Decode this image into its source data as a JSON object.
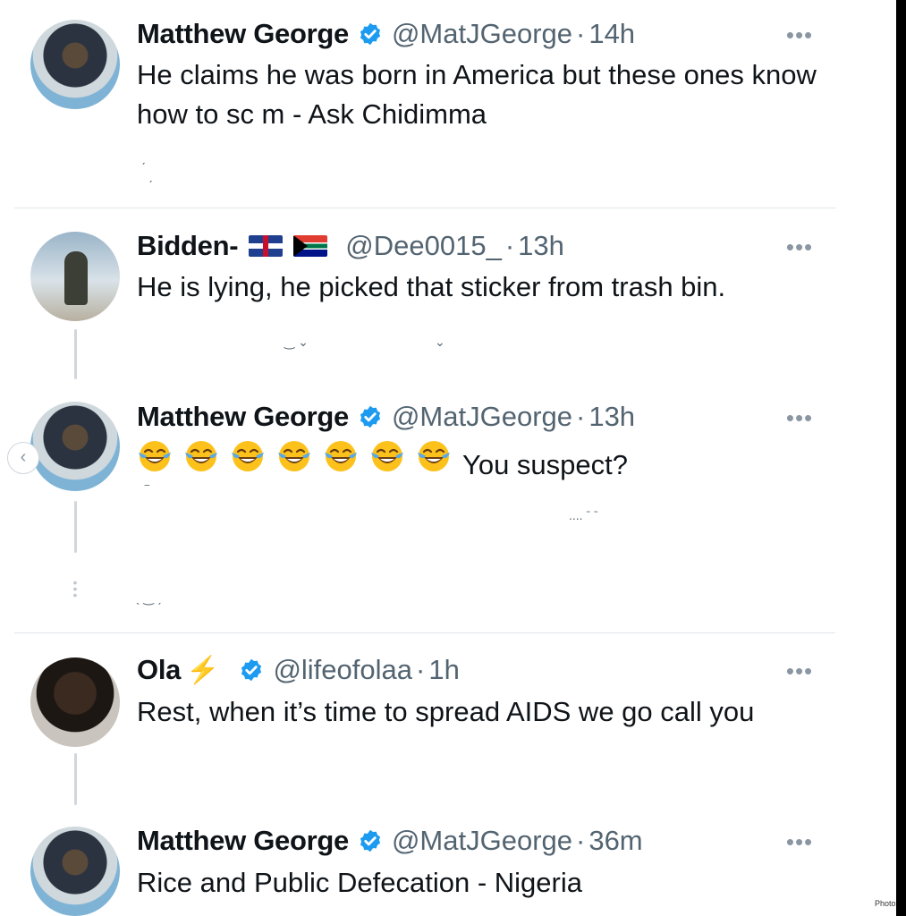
{
  "tweets": [
    {
      "name": "Matthew George",
      "handle": "@MatJGeorge",
      "time": "14h",
      "text": "He claims he was born in America but these ones know how to sc  m - Ask Chidimma",
      "verified": true,
      "more": "•••"
    },
    {
      "name": "Bidden-",
      "handle": "@Dee0015_",
      "time": "13h",
      "text": "He is lying, he picked that sticker from trash bin.",
      "flags": [
        "uk-flag",
        "south-africa-flag"
      ],
      "more": "•••"
    },
    {
      "name": "Matthew George",
      "handle": "@MatJGeorge",
      "time": "13h",
      "emoji_count": 7,
      "emoji": "face-with-tears-of-joy",
      "text": "You suspect?",
      "verified": true,
      "more": "•••"
    },
    {
      "name": "Ola",
      "name_suffix": "⚡",
      "handle": "@lifeofolaa",
      "time": "1h",
      "text": "Rest, when it’s time to spread AIDS we go call you",
      "verified": true,
      "more": "•••"
    },
    {
      "name": "Matthew George",
      "handle": "@MatJGeorge",
      "time": "36m",
      "text": "Rice and Public Defecation - Nigeria",
      "verified": true,
      "more": "•••"
    }
  ],
  "separator": "·",
  "nav": {
    "prev_label": "‹"
  },
  "watermark": "PhotoG",
  "colors": {
    "verified": "#1d9bf0",
    "text": "#0f1419",
    "muted": "#536471"
  }
}
